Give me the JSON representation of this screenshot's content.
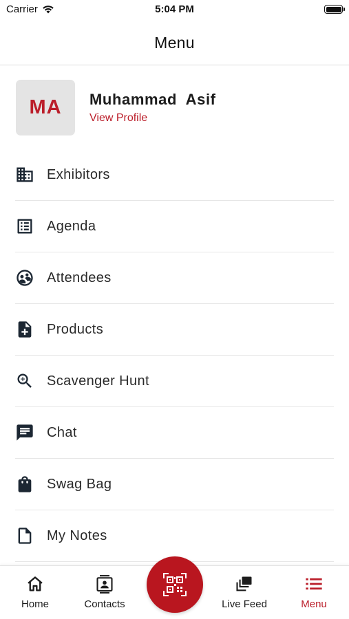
{
  "status_bar": {
    "carrier": "Carrier",
    "time": "5:04 PM"
  },
  "header": {
    "title": "Menu"
  },
  "profile": {
    "initials": "MA",
    "name": "Muhammad  Asif",
    "link": "View Profile"
  },
  "menu": {
    "items": [
      {
        "label": "Exhibitors",
        "icon": "building-icon"
      },
      {
        "label": "Agenda",
        "icon": "list-icon"
      },
      {
        "label": "Attendees",
        "icon": "people-icon"
      },
      {
        "label": "Products",
        "icon": "add-document-icon"
      },
      {
        "label": "Scavenger Hunt",
        "icon": "zoom-in-icon"
      },
      {
        "label": "Chat",
        "icon": "chat-icon"
      },
      {
        "label": "Swag Bag",
        "icon": "shopping-bag-icon"
      },
      {
        "label": "My Notes",
        "icon": "document-icon"
      }
    ]
  },
  "tab_bar": {
    "home": "Home",
    "contacts": "Contacts",
    "live_feed": "Live Feed",
    "menu": "Menu",
    "active": "menu"
  },
  "colors": {
    "accent": "#bb1e2a",
    "icon": "#1c2733"
  }
}
